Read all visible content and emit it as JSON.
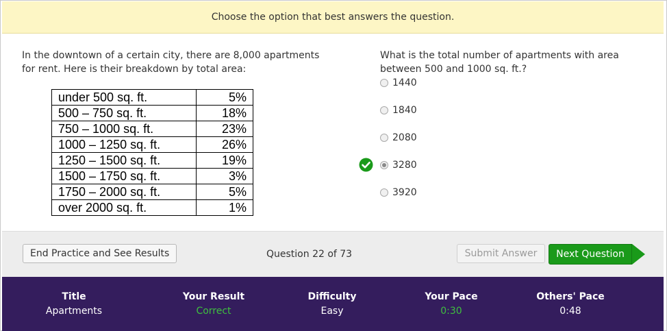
{
  "instruction": "Choose the option that best answers the question.",
  "passage": {
    "line1": "In the downtown of a certain city, there are 8,000 apartments",
    "line2": "for rent. Here is their breakdown by total area:"
  },
  "table": {
    "rows": [
      {
        "range": "under 500 sq. ft.",
        "percent": "5%"
      },
      {
        "range": "500 – 750 sq. ft.",
        "percent": "18%"
      },
      {
        "range": "750 – 1000 sq. ft.",
        "percent": "23%"
      },
      {
        "range": "1000 – 1250 sq. ft.",
        "percent": "26%"
      },
      {
        "range": "1250 – 1500 sq. ft.",
        "percent": "19%"
      },
      {
        "range": "1500 – 1750 sq. ft.",
        "percent": "3%"
      },
      {
        "range": "1750 – 2000 sq. ft.",
        "percent": "5%"
      },
      {
        "range": "over 2000 sq. ft.",
        "percent": "1%"
      }
    ]
  },
  "question": {
    "line1": "What is the total number of apartments with area",
    "line2": "between 500 and 1000 sq. ft.?",
    "options": [
      "1440",
      "1840",
      "2080",
      "3280",
      "3920"
    ],
    "selected_index": 3,
    "correct_index": 3
  },
  "nav": {
    "end_label": "End Practice and See Results",
    "counter": "Question 22 of 73",
    "submit_label": "Submit Answer",
    "next_label": "Next Question"
  },
  "stats": {
    "title_label": "Title",
    "title_value": "Apartments",
    "result_label": "Your Result",
    "result_value": "Correct",
    "difficulty_label": "Difficulty",
    "difficulty_value": "Easy",
    "pace_label": "Your Pace",
    "pace_value": "0:30",
    "others_label": "Others' Pace",
    "others_value": "0:48"
  },
  "colors": {
    "instruction_bg": "#fdf6c5",
    "stats_bg": "#341d5d",
    "accent_green": "#1a9a1a",
    "correct_text": "#3fbf3f"
  }
}
